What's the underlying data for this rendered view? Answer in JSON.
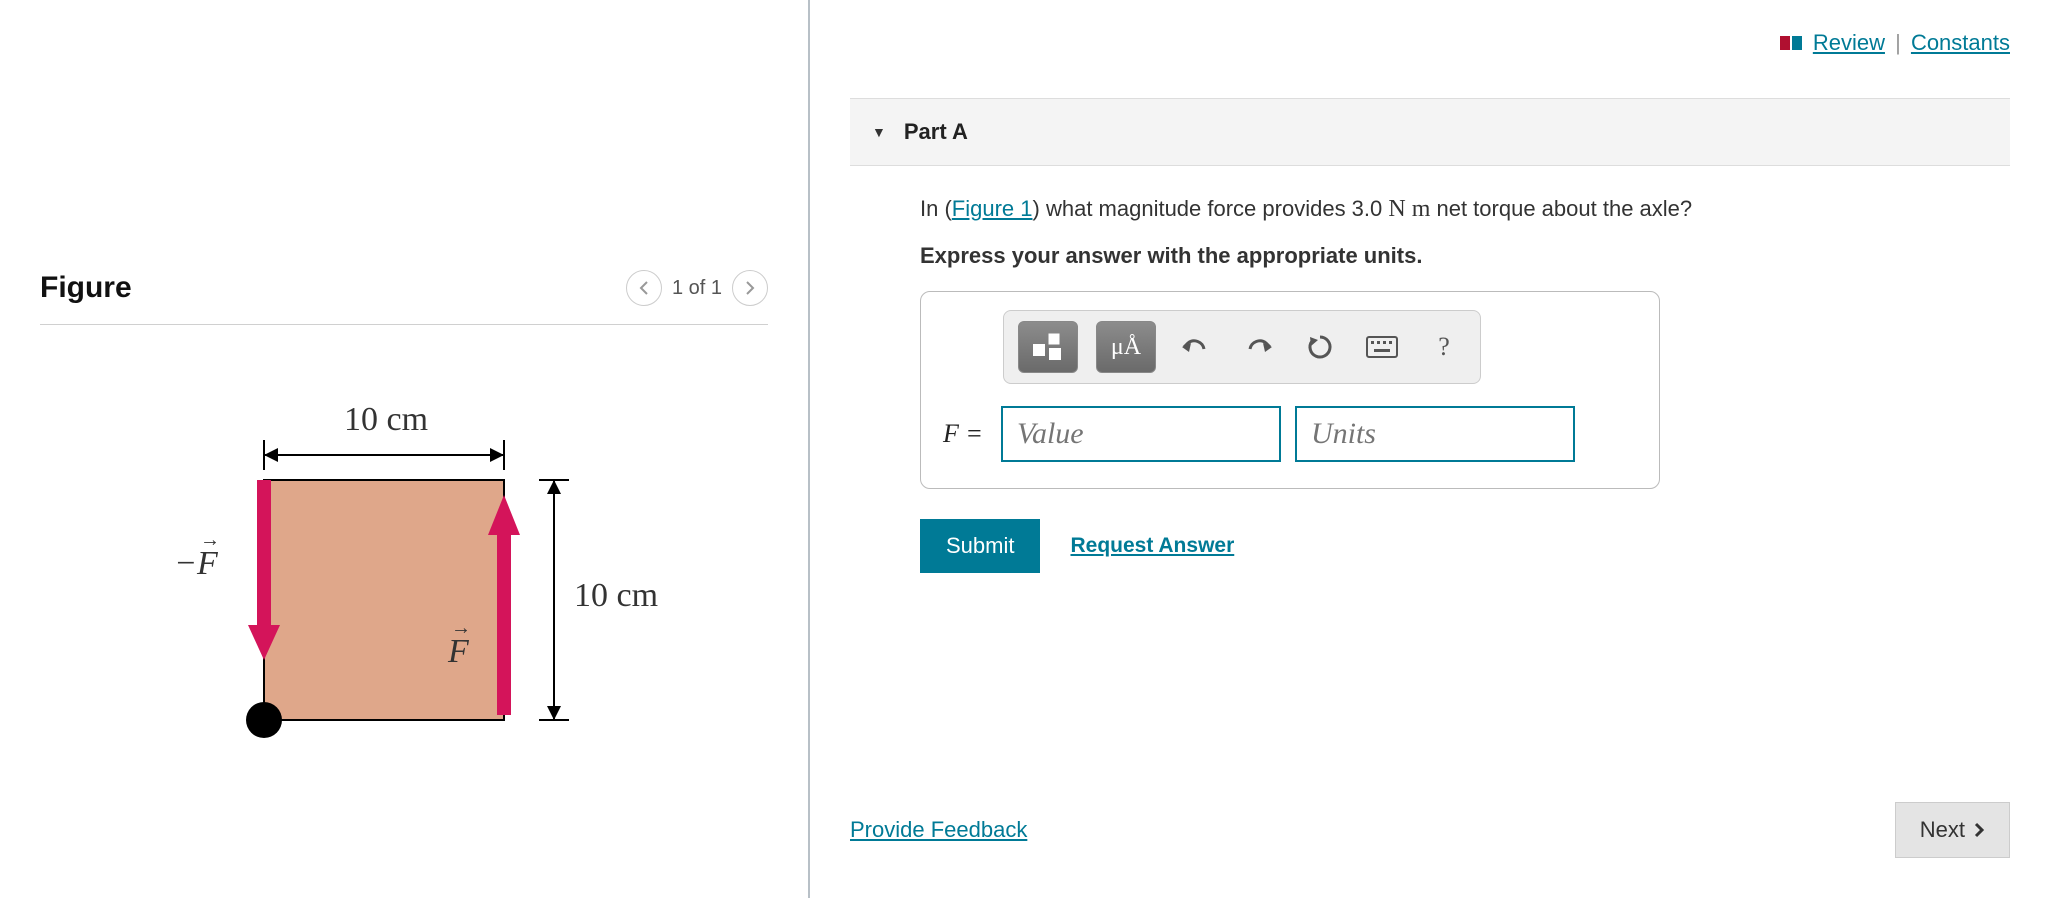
{
  "top": {
    "review": "Review",
    "constants": "Constants"
  },
  "figure": {
    "title": "Figure",
    "pager": "1 of 1",
    "dim_top": "10 cm",
    "dim_right": "10 cm",
    "force_neg": "−F⃗",
    "force_pos": "F⃗"
  },
  "part": {
    "label": "Part A",
    "question_pre": "In (",
    "question_link": "Figure 1",
    "question_post": ") what magnitude force provides 3.0 ",
    "question_unit": "N m",
    "question_tail": " net torque about the axle?",
    "instructions": "Express your answer with the appropriate units.",
    "prefix": "F =",
    "value_placeholder": "Value",
    "units_placeholder": "Units",
    "toolbar_units": "μÅ",
    "submit": "Submit",
    "request": "Request Answer",
    "help_q": "?"
  },
  "footer": {
    "feedback": "Provide Feedback",
    "next": "Next"
  }
}
